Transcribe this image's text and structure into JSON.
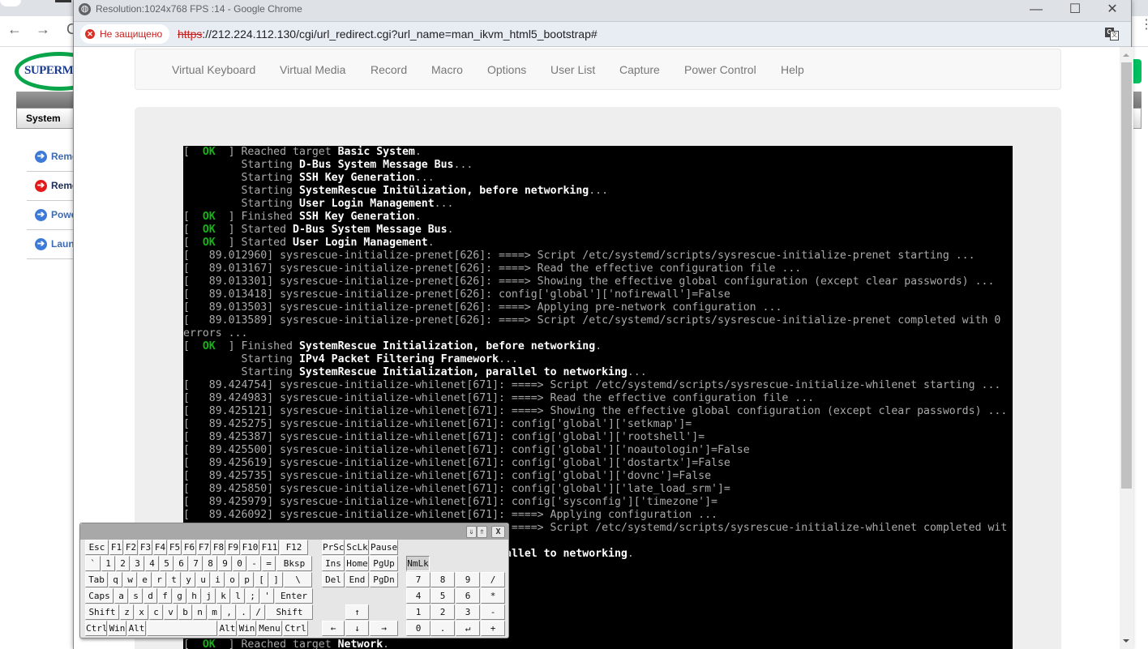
{
  "background_browser": {
    "nav": {
      "back": "←",
      "forward": "→",
      "reload": "C"
    },
    "logo_text": "SUPERMICRO",
    "system_tab": "System",
    "side_links": [
      {
        "label": "Remote Control",
        "icon": "arrow-right-circle-icon",
        "color": "#3d79d7"
      },
      {
        "label": "Remote Console",
        "icon": "arrow-right-circle-icon",
        "color": "#e41a1a"
      },
      {
        "label": "Power Control",
        "icon": "arrow-right-circle-icon",
        "color": "#3d79d7"
      },
      {
        "label": "Launch SOL",
        "icon": "arrow-right-circle-icon",
        "color": "#3d79d7"
      }
    ],
    "side_links_visible": [
      "Reme",
      "Reme",
      "Powe",
      "Laun"
    ]
  },
  "window": {
    "title": "Resolution:1024x768 FPS :14 - Google Chrome",
    "controls": {
      "minimize": "—",
      "maximize": "☐",
      "close": "✕"
    },
    "security_label": "Не защищено",
    "url_scheme": "https",
    "url_rest": "://212.224.112.130/cgi/url_redirect.cgi?url_name=man_ikvm_html5_bootstrap#"
  },
  "menu": {
    "items": [
      "Virtual Keyboard",
      "Virtual Media",
      "Record",
      "Macro",
      "Options",
      "User List",
      "Capture",
      "Power Control",
      "Help"
    ]
  },
  "terminal": {
    "lines": [
      {
        "ok": true,
        "pre": "Reached target ",
        "bright": "Basic System",
        "post": "."
      },
      {
        "indent": true,
        "pre": "Starting ",
        "bright": "D-Bus System Message Bus",
        "post": "..."
      },
      {
        "indent": true,
        "pre": "Starting ",
        "bright": "SSH Key Generation",
        "post": "..."
      },
      {
        "indent": true,
        "pre": "Starting ",
        "bright": "SystemRescue Initūlization, before networking",
        "post": "..."
      },
      {
        "indent": true,
        "pre": "Starting ",
        "bright": "User Login Management",
        "post": "..."
      },
      {
        "ok": true,
        "pre": "Finished ",
        "bright": "SSH Key Generation",
        "post": "."
      },
      {
        "ok": true,
        "pre": "Started ",
        "bright": "D-Bus System Message Bus",
        "post": "."
      },
      {
        "ok": true,
        "pre": "Started ",
        "bright": "User Login Management",
        "post": "."
      },
      {
        "text": "[   89.012960] sysrescue-initialize-prenet[626]: ====> Script /etc/systemd/scripts/sysrescue-initialize-prenet starting ..."
      },
      {
        "text": "[   89.013167] sysrescue-initialize-prenet[626]: ====> Read the effective configuration file ..."
      },
      {
        "text": "[   89.013301] sysrescue-initialize-prenet[626]: ====> Showing the effective global configuration (except clear passwords) ..."
      },
      {
        "text": "[   89.013418] sysrescue-initialize-prenet[626]: config['global']['nofirewall']=False"
      },
      {
        "text": "[   89.013503] sysrescue-initialize-prenet[626]: ====> Applying pre-network configuration ..."
      },
      {
        "text": "[   89.013589] sysrescue-initialize-prenet[626]: ====> Script /etc/systemd/scripts/sysrescue-initialize-prenet completed with 0"
      },
      {
        "text": "errors ..."
      },
      {
        "ok": true,
        "pre": "Finished ",
        "bright": "SystemRescue Initialization, before networking",
        "post": "."
      },
      {
        "indent": true,
        "pre": "Starting ",
        "bright": "IPv4 Packet Filtering Framework",
        "post": "..."
      },
      {
        "indent": true,
        "pre": "Starting ",
        "bright": "SystemRescue Initialization, parallel to networking",
        "post": "..."
      },
      {
        "text": "[   89.424754] sysrescue-initialize-whilenet[671]: ====> Script /etc/systemd/scripts/sysrescue-initialize-whilenet starting ..."
      },
      {
        "text": "[   89.424983] sysrescue-initialize-whilenet[671]: ====> Read the effective configuration file ..."
      },
      {
        "text": "[   89.425121] sysrescue-initialize-whilenet[671]: ====> Showing the effective global configuration (except clear passwords) ..."
      },
      {
        "text": "[   89.425275] sysrescue-initialize-whilenet[671]: config['global']['setkmap']="
      },
      {
        "text": "[   89.425387] sysrescue-initialize-whilenet[671]: config['global']['rootshell']="
      },
      {
        "text": "[   89.425500] sysrescue-initialize-whilenet[671]: config['global']['noautologin']=False"
      },
      {
        "text": "[   89.425619] sysrescue-initialize-whilenet[671]: config['global']['dostartx']=False"
      },
      {
        "text": "[   89.425735] sysrescue-initialize-whilenet[671]: config['global']['dovnc']=False"
      },
      {
        "text": "[   89.425850] sysrescue-initialize-whilenet[671]: config['global']['late_load_srm']="
      },
      {
        "text": "[   89.425979] sysrescue-initialize-whilenet[671]: config['sysconfig']['timezone']="
      },
      {
        "text": "[   89.426092] sysrescue-initialize-whilenet[671]: ====> Applying configuration ..."
      },
      {
        "text": "[   89.426199] sysrescue-initialize-whilenet[671]: ====> Script /etc/systemd/scripts/sysrescue-initialize-whilenet completed wit"
      },
      {
        "text": ""
      },
      {
        "ok": true,
        "pre": "Finished ",
        "bright": "SystemRescue Initialization, parallel to networking",
        "post": "."
      },
      {
        "text": ""
      },
      {
        "text": "                                                ..."
      },
      {
        "text": ""
      },
      {
        "text": ""
      },
      {
        "text": ""
      },
      {
        "text": ""
      },
      {
        "ok": true,
        "pre": "Reached target ",
        "bright": "Network",
        "post": "."
      }
    ],
    "ok_label": "OK"
  },
  "keyboard": {
    "head_buttons": {
      "down": "⇓",
      "up": "⇑",
      "close": "X"
    },
    "rows": [
      [
        "Esc",
        "F1",
        "F2",
        "F3",
        "F4",
        "F5",
        "F6",
        "F7",
        "F8",
        "F9",
        "F10",
        "F11",
        "F12"
      ],
      [
        "`",
        "1",
        "2",
        "3",
        "4",
        "5",
        "6",
        "7",
        "8",
        "9",
        "0",
        "-",
        "=",
        "Bksp"
      ],
      [
        "Tab",
        "q",
        "w",
        "e",
        "r",
        "t",
        "y",
        "u",
        "i",
        "o",
        "p",
        "[",
        "]",
        "\\"
      ],
      [
        "Caps",
        "a",
        "s",
        "d",
        "f",
        "g",
        "h",
        "j",
        "k",
        "l",
        ";",
        "'",
        "Enter"
      ],
      [
        "Shift",
        "z",
        "x",
        "c",
        "v",
        "b",
        "n",
        "m",
        ",",
        ".",
        "/",
        "Shift"
      ],
      [
        "Ctrl",
        "Win",
        "Alt",
        "",
        "Alt",
        "Win",
        "Menu",
        "Ctrl"
      ]
    ],
    "nav_keys": [
      [
        "PrSc",
        "ScLk",
        "Pause"
      ],
      [
        "Ins",
        "Home",
        "PgUp"
      ],
      [
        "Del",
        "End",
        "PgDn"
      ],
      [
        "",
        "",
        ""
      ],
      [
        "",
        "↑",
        ""
      ],
      [
        "←",
        "↓",
        "→"
      ]
    ],
    "numpad": [
      [
        "NmLk"
      ],
      [
        "7",
        "8",
        "9",
        "/"
      ],
      [
        "4",
        "5",
        "6",
        "*"
      ],
      [
        "1",
        "2",
        "3",
        "-"
      ],
      [
        "0",
        ".",
        "↵",
        "+"
      ]
    ],
    "numlock_pressed": true
  }
}
